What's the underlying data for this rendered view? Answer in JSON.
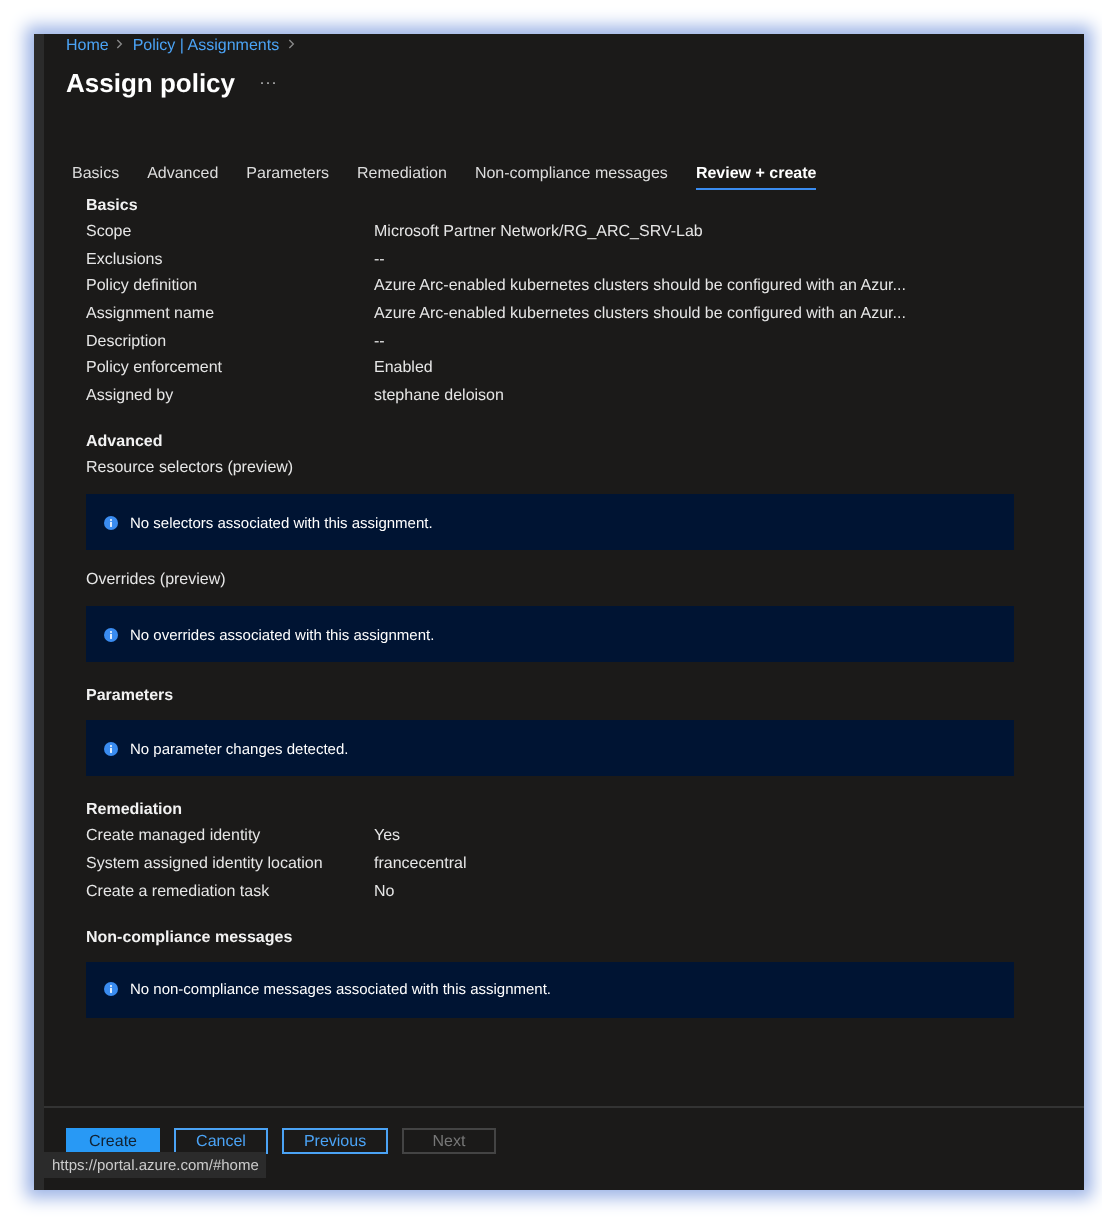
{
  "breadcrumb": [
    "Home",
    "Policy | Assignments"
  ],
  "title": "Assign policy",
  "more": "···",
  "tabs": [
    {
      "label": "Basics",
      "selected": false
    },
    {
      "label": "Advanced",
      "selected": false
    },
    {
      "label": "Parameters",
      "selected": false
    },
    {
      "label": "Remediation",
      "selected": false
    },
    {
      "label": "Non-compliance messages",
      "selected": false
    },
    {
      "label": "Review + create",
      "selected": true
    }
  ],
  "sections": [
    {
      "title": "Basics",
      "items": [
        {
          "kind": "row",
          "label": "Scope",
          "value": "Microsoft Partner Network/RG_ARC_SRV-Lab"
        },
        {
          "kind": "row",
          "label": "Exclusions",
          "value": "--"
        },
        {
          "kind": "row",
          "label": "Policy definition",
          "value": "Azure Arc-enabled kubernetes clusters should be configured with an Azur..."
        },
        {
          "kind": "row",
          "label": "Assignment name",
          "value": "Azure Arc-enabled kubernetes clusters should be configured with an Azur..."
        },
        {
          "kind": "row",
          "label": "Description",
          "value": "--"
        },
        {
          "kind": "row",
          "label": "Policy enforcement",
          "value": "Enabled"
        },
        {
          "kind": "row",
          "label": "Assigned by",
          "value": "stephane deloison"
        }
      ]
    },
    {
      "title": "Advanced",
      "items": [
        {
          "kind": "label",
          "text": "Resource selectors (preview)"
        },
        {
          "kind": "info",
          "text": "No selectors associated with this assignment."
        },
        {
          "kind": "label",
          "text": "Overrides (preview)"
        },
        {
          "kind": "info",
          "text": "No overrides associated with this assignment."
        }
      ]
    },
    {
      "title": "Parameters",
      "items": [
        {
          "kind": "info",
          "text": "No parameter changes detected."
        }
      ]
    },
    {
      "title": "Remediation",
      "items": [
        {
          "kind": "row",
          "label": "Create managed identity",
          "value": "Yes"
        },
        {
          "kind": "row",
          "label": "System assigned identity location",
          "value": "francecentral"
        },
        {
          "kind": "row",
          "label": "Create a remediation task",
          "value": "No"
        }
      ]
    },
    {
      "title": "Non-compliance messages",
      "items": [
        {
          "kind": "info",
          "text": "No non-compliance messages associated with this assignment."
        }
      ]
    }
  ],
  "buttons": [
    {
      "label": "Create",
      "kind": "primary",
      "disabled": false
    },
    {
      "label": "Cancel",
      "kind": "outline",
      "disabled": false
    },
    {
      "label": "Previous",
      "kind": "outline",
      "disabled": false
    },
    {
      "label": "Next",
      "kind": "outline",
      "disabled": true
    }
  ],
  "status_url": "https://portal.azure.com/#home"
}
